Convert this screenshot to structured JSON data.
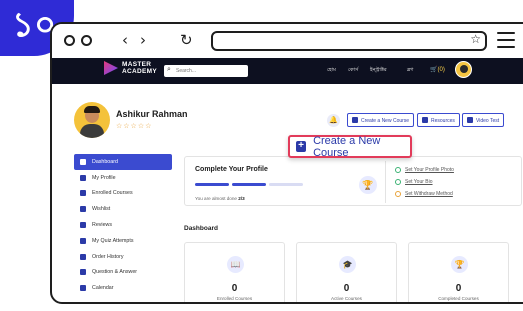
{
  "step_badge": "১০",
  "browser": {
    "back_glyph": "‹",
    "forward_glyph": "›",
    "reload_glyph": "↻",
    "star_glyph": "☆"
  },
  "header": {
    "logo_line1": "MASTER",
    "logo_line2": "ACADEMY",
    "search_placeholder": "Search...",
    "nav": [
      "হোম",
      "কোর্স",
      "ইন্স্ট্রাক্টর",
      "ব্লগ"
    ],
    "cart_label": "(0)"
  },
  "profile": {
    "name": "Ashikur Rahman",
    "stars": "☆☆☆☆☆"
  },
  "actions": {
    "create_course": "Create a New Course",
    "resources": "Resources",
    "video_test": "Video Test"
  },
  "popup": {
    "label": "Create a New Course"
  },
  "sidebar": {
    "items": [
      {
        "label": "Dashboard",
        "icon": "gauge-icon"
      },
      {
        "label": "My Profile",
        "icon": "user-icon"
      },
      {
        "label": "Enrolled Courses",
        "icon": "graduation-cap-icon"
      },
      {
        "label": "Wishlist",
        "icon": "bookmark-icon"
      },
      {
        "label": "Reviews",
        "icon": "star-icon"
      },
      {
        "label": "My Quiz Attempts",
        "icon": "sitemap-icon"
      },
      {
        "label": "Order History",
        "icon": "cart-icon"
      },
      {
        "label": "Question & Answer",
        "icon": "question-icon"
      },
      {
        "label": "Calendar",
        "icon": "calendar-icon"
      }
    ]
  },
  "complete_profile": {
    "title": "Complete Your Profile",
    "done_prefix": "You are almost done",
    "done_count": "2/3",
    "progress_filled": 2,
    "progress_total": 3,
    "tasks": [
      {
        "label": "Set Your Profile Photo",
        "state": "done"
      },
      {
        "label": "Set Your Bio",
        "state": "done"
      },
      {
        "label": "Set Withdraw Method",
        "state": "pending"
      }
    ]
  },
  "dashboard": {
    "title": "Dashboard",
    "stats": [
      {
        "value": "0",
        "label": "Enrolled Courses",
        "icon": "book-icon"
      },
      {
        "value": "0",
        "label": "Active Courses",
        "icon": "graduation-cap-icon"
      },
      {
        "value": "0",
        "label": "Completed Courses",
        "icon": "trophy-icon"
      }
    ]
  },
  "colors": {
    "accent": "#3b4bd0",
    "badge": "#2f2bd6",
    "highlight_border": "#e23b5a",
    "progress_filled": "#3b4bd0",
    "progress_empty": "#d9dcf3"
  }
}
